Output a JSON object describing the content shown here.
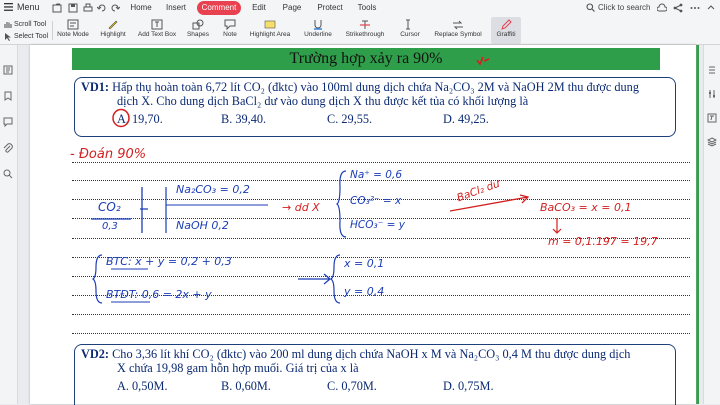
{
  "menubar": {
    "menu_label": "Menu",
    "tabs": [
      {
        "label": "Home"
      },
      {
        "label": "Insert"
      },
      {
        "label": "Comment",
        "active": true
      },
      {
        "label": "Edit"
      },
      {
        "label": "Page"
      },
      {
        "label": "Protect"
      },
      {
        "label": "Tools"
      }
    ],
    "search_label": "Click to search"
  },
  "ribbon": {
    "scroll_tool": "Scroll Tool",
    "select_tool": "Select Tool",
    "tools": [
      {
        "label": "Note Mode",
        "icon": "note-mode-icon"
      },
      {
        "label": "Highlight",
        "icon": "highlight-icon"
      },
      {
        "label": "Add Text Box",
        "icon": "text-box-icon"
      },
      {
        "label": "Shapes",
        "icon": "shapes-icon"
      },
      {
        "label": "Note",
        "icon": "note-icon"
      },
      {
        "label": "Highlight Area",
        "icon": "highlight-area-icon"
      },
      {
        "label": "Underline",
        "icon": "underline-icon"
      },
      {
        "label": "Strikethrough",
        "icon": "strikethrough-icon"
      },
      {
        "label": "Cursor",
        "icon": "cursor-icon"
      },
      {
        "label": "Replace Symbol",
        "icon": "replace-symbol-icon"
      },
      {
        "label": "Graffiti",
        "icon": "graffiti-icon",
        "selected": true
      }
    ]
  },
  "colors": {
    "accent": "#e8414f",
    "banner": "#2f9e4a",
    "question_text": "#0b2a73",
    "ink_blue": "#1c3db6",
    "ink_red": "#d32020"
  },
  "document": {
    "banner_title": "Trường hợp xảy ra 90%",
    "vd1": {
      "label": "VD1:",
      "line1": "Hấp thụ hoàn toàn 6,72 lít CO₂ (đktc) vào 100ml dung dịch chứa Na₂CO₃ 2M và NaOH 2M thu được dung",
      "line2": "dịch X. Cho dung dịch BaCl₂ dư vào dung dịch X thu được kết tủa có khối lượng là",
      "options": [
        "A. 19,70.",
        "B. 39,40.",
        "C. 29,55.",
        "D. 49,25."
      ]
    },
    "vd2": {
      "label": "VD2:",
      "line1": "Cho 3,36 lít khí CO₂ (đktc) vào 200 ml dung dịch chứa NaOH x M và Na₂CO₃ 0,4 M thu được dung dịch",
      "line2": "X chứa 19,98 gam hỗn hợp muối. Giá trị của x là",
      "options": [
        "A. 0,50M.",
        "B. 0,60M.",
        "C. 0,70M.",
        "D. 0,75M."
      ]
    },
    "handwriting": {
      "doan": "- Đoán 90%",
      "co2": "CO₂",
      "co2_mol": "0,3",
      "na2co3": "Na₂CO₃ = 0,2",
      "naoh": "NaOH  0,2",
      "ddx": "→ dd X",
      "na_plus": "Na⁺ = 0,6",
      "co3": "CO₃²⁻ = x",
      "hco3": "HCO₃⁻ = y",
      "bacl2": "BaCl₂ dư",
      "baco3": "BaCO₃ = x = 0,1",
      "m_result": "m = 0,1.197 = 19,7",
      "btc": "BTC: x + y = 0,2 + 0,3",
      "btdt": "BTĐT: 0,6 = 2x + y",
      "x_val": "x = 0,1",
      "y_val": "y = 0,4"
    }
  }
}
